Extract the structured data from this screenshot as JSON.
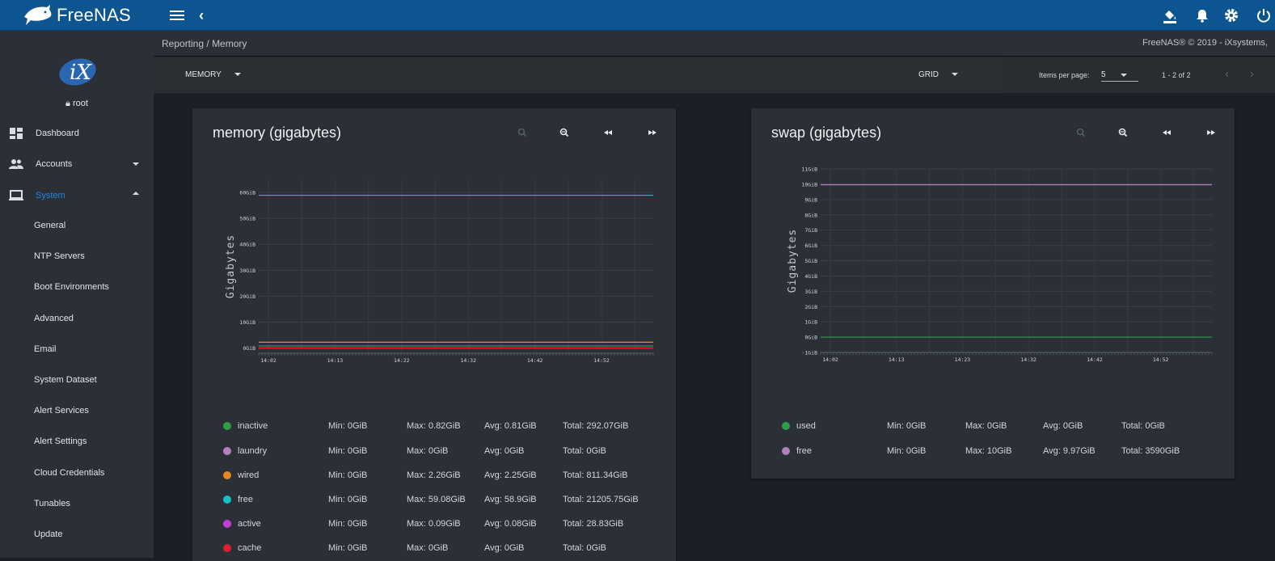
{
  "app": {
    "brand": "FreeNAS",
    "user": "root"
  },
  "sidebar": {
    "items": [
      {
        "label": "Dashboard",
        "icon": "dashboard-icon"
      },
      {
        "label": "Accounts",
        "icon": "people-icon"
      },
      {
        "label": "System",
        "icon": "computer-icon"
      }
    ],
    "system_sub": [
      "General",
      "NTP Servers",
      "Boot Environments",
      "Advanced",
      "Email",
      "System Dataset",
      "Alert Services",
      "Alert Settings",
      "Cloud Credentials",
      "Tunables",
      "Update"
    ]
  },
  "breadcrumb": {
    "parent": "Reporting",
    "sep": "/",
    "current": "Memory"
  },
  "copyright": "FreeNAS® © 2019 - iXsystems,",
  "toolbar": {
    "report": "MEMORY",
    "layout": "GRID",
    "items_per_page_label": "Items per page:",
    "items_per_page": "5",
    "range": "1 - 2 of 2"
  },
  "colors": {
    "topbar": "#0d5591",
    "accent": "#1e88e5",
    "inactive": "#2e9d47",
    "laundry": "#b37fbf",
    "wired": "#e6871f",
    "free": "#17bfc8",
    "active": "#c43fd4",
    "cache": "#dc1f2b"
  },
  "charts": [
    {
      "title": "memory (gigabytes)",
      "legend": [
        {
          "name": "inactive",
          "color": "#2e9d47",
          "min": "Min: 0GiB",
          "max": "Max: 0.82GiB",
          "avg": "Avg: 0.81GiB",
          "total": "Total: 292.07GiB"
        },
        {
          "name": "laundry",
          "color": "#b37fbf",
          "min": "Min: 0GiB",
          "max": "Max: 0GiB",
          "avg": "Avg: 0GiB",
          "total": "Total: 0GiB"
        },
        {
          "name": "wired",
          "color": "#e6871f",
          "min": "Min: 0GiB",
          "max": "Max: 2.26GiB",
          "avg": "Avg: 2.25GiB",
          "total": "Total: 811.34GiB"
        },
        {
          "name": "free",
          "color": "#17bfc8",
          "min": "Min: 0GiB",
          "max": "Max: 59.08GiB",
          "avg": "Avg: 58.9GiB",
          "total": "Total: 21205.75GiB"
        },
        {
          "name": "active",
          "color": "#c43fd4",
          "min": "Min: 0GiB",
          "max": "Max: 0.09GiB",
          "avg": "Avg: 0.08GiB",
          "total": "Total: 28.83GiB"
        },
        {
          "name": "cache",
          "color": "#dc1f2b",
          "min": "Min: 0GiB",
          "max": "Max: 0GiB",
          "avg": "Avg: 0GiB",
          "total": "Total: 0GiB"
        }
      ]
    },
    {
      "title": "swap (gigabytes)",
      "legend": [
        {
          "name": "used",
          "color": "#2e9d47",
          "min": "Min: 0GiB",
          "max": "Max: 0GiB",
          "avg": "Avg: 0GiB",
          "total": "Total: 0GiB"
        },
        {
          "name": "free",
          "color": "#b37fbf",
          "min": "Min: 0GiB",
          "max": "Max: 10GiB",
          "avg": "Avg: 9.97GiB",
          "total": "Total: 3590GiB"
        }
      ]
    }
  ],
  "chart_data": [
    {
      "type": "line",
      "title": "memory (gigabytes)",
      "ylabel": "Gigabytes",
      "ylim": [
        -2,
        65
      ],
      "yticks": [
        0,
        10,
        20,
        30,
        40,
        50,
        60
      ],
      "ytick_labels": [
        "0GiB",
        "10GiB",
        "20GiB",
        "30GiB",
        "40GiB",
        "50GiB",
        "60GiB"
      ],
      "x": [
        "14:02",
        "14:13",
        "14:22",
        "14:32",
        "14:42",
        "14:52"
      ],
      "grid": true,
      "series": [
        {
          "name": "inactive",
          "color": "#2e9d47",
          "values": [
            0.81,
            0.81,
            0.81,
            0.81,
            0.81,
            0.81
          ]
        },
        {
          "name": "laundry",
          "color": "#b37fbf",
          "values": [
            0,
            0,
            0,
            0,
            0,
            0
          ]
        },
        {
          "name": "wired",
          "color": "#e6871f",
          "values": [
            2.25,
            2.25,
            2.25,
            2.25,
            2.25,
            2.25
          ]
        },
        {
          "name": "free",
          "color": "#17bfc8",
          "values": [
            58.9,
            58.9,
            58.9,
            58.9,
            58.9,
            58.9
          ]
        },
        {
          "name": "active",
          "color": "#c43fd4",
          "values": [
            0.08,
            0.08,
            0.08,
            0.08,
            0.08,
            0.08
          ]
        },
        {
          "name": "cache",
          "color": "#dc1f2b",
          "values": [
            0,
            0,
            0,
            0,
            0,
            0
          ]
        }
      ]
    },
    {
      "type": "line",
      "title": "swap (gigabytes)",
      "ylabel": "Gigabytes",
      "ylim": [
        -1,
        11
      ],
      "yticks": [
        -1,
        0,
        1,
        2,
        3,
        4,
        5,
        6,
        7,
        8,
        9,
        10,
        11
      ],
      "ytick_labels": [
        "-1GiB",
        "0GiB",
        "1GiB",
        "2GiB",
        "3GiB",
        "4GiB",
        "5GiB",
        "6GiB",
        "7GiB",
        "8GiB",
        "9GiB",
        "10GiB",
        "11GiB"
      ],
      "x": [
        "14:02",
        "14:13",
        "14:23",
        "14:32",
        "14:42",
        "14:52"
      ],
      "grid": true,
      "series": [
        {
          "name": "used",
          "color": "#2e9d47",
          "values": [
            0,
            0,
            0,
            0,
            0,
            0
          ]
        },
        {
          "name": "free",
          "color": "#b37fbf",
          "values": [
            9.97,
            9.97,
            9.97,
            9.97,
            9.97,
            9.97
          ]
        }
      ]
    }
  ]
}
